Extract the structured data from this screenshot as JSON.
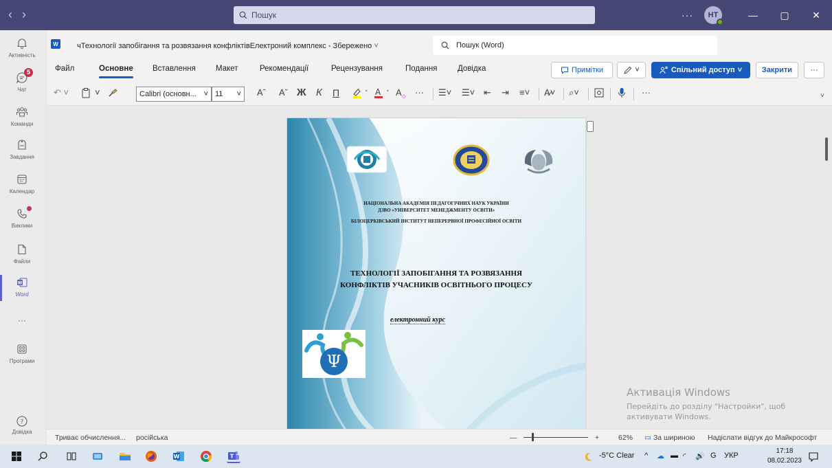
{
  "titlebar": {
    "back": "‹",
    "forward": "›",
    "search_placeholder": "Пошук",
    "more": "···",
    "avatar_initials": "НТ",
    "minimize": "—",
    "maximize": "▢",
    "close": "✕"
  },
  "rail": {
    "items": [
      {
        "label": "Активність",
        "icon": "bell-icon"
      },
      {
        "label": "Чат",
        "icon": "chat-icon",
        "badge": "5"
      },
      {
        "label": "Команди",
        "icon": "teams-icon"
      },
      {
        "label": "Завдання",
        "icon": "assignments-icon"
      },
      {
        "label": "Календар",
        "icon": "calendar-icon"
      },
      {
        "label": "Виклики",
        "icon": "phone-icon"
      },
      {
        "label": "Файли",
        "icon": "file-icon"
      },
      {
        "label": "Word",
        "icon": "word-icon"
      },
      {
        "label": "···",
        "icon": "more-icon"
      },
      {
        "label": "Програми",
        "icon": "apps-icon"
      }
    ],
    "help": "Довідка"
  },
  "word": {
    "doc_title": "чТехнології запобігання та розвязання конфліктівЕлектроний комплекс  -  Збережено",
    "search_placeholder": "Пошук (Word)",
    "tabs": [
      "Файл",
      "Основне",
      "Вставлення",
      "Макет",
      "Рекомендації",
      "Рецензування",
      "Подання",
      "Довідка"
    ],
    "active_tab": "Основне",
    "comments_btn": "Примітки",
    "share_btn": "Спільний доступ",
    "close_btn": "Закрити",
    "more_btn": "···",
    "font_name": "Calibri (основн...",
    "font_size": "11",
    "bold": "Ж",
    "italic": "К",
    "underline": "П"
  },
  "document": {
    "org_line1": "НАЦІОНАЛЬНА АКАДЕМІЯ ПЕДАГОГІЧНИХ НАУК УКРАЇНИ",
    "org_line2": "ДЗВО «УНІВЕРСИТЕТ МЕНЕДЖМЕНТУ ОСВІТИ»",
    "org_line3": "БІЛОЦЕРКІВСЬКИЙ ІНСТИТУТ НЕПЕРЕРВНОЇ ПРОФЕСІЙНОЇ ОСВІТИ",
    "title_line1": "ТЕХНОЛОГІЇ  ЗАПОБІГАННЯ ТА РОЗВЯЗАННЯ",
    "title_line2": "КОНФЛІКТІВ УЧАСНИКІВ ОСВІТНЬОГО ПРОЦЕСУ",
    "subtitle": "електронний курс"
  },
  "activation": {
    "title": "Активація Windows",
    "line1": "Перейдіть до розділу \"Настройки\", щоб",
    "line2": "активувати Windows."
  },
  "statusbar": {
    "calc": "Триває обчислення...",
    "language": "російська",
    "zoom_minus": "—",
    "zoom_plus": "+",
    "zoom": "62%",
    "fit_width": "За шириною",
    "feedback": "Надіслати відгук до Майкрософт"
  },
  "taskbar": {
    "weather": "-5°C  Clear",
    "lang": "УКР",
    "time": "17:18",
    "date": "08.02.2023"
  },
  "colors": {
    "teams_header": "#464775",
    "word_blue": "#185abd",
    "badge_red": "#c4314b",
    "taskbar": "#dbe6f1"
  }
}
